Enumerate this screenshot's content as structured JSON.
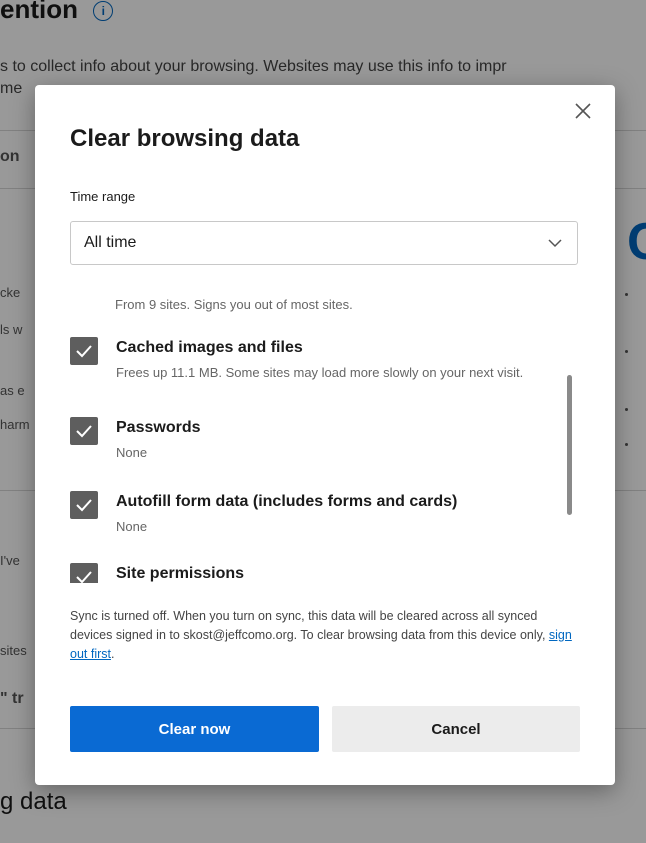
{
  "background": {
    "heading": "ention",
    "description_line1": "s to collect info about your browsing. Websites may use this info to impr",
    "description_line2": "me",
    "fragments": [
      "on",
      "cke",
      "ls w",
      "as e",
      "harm",
      "I've",
      "sites",
      "\" tr"
    ],
    "footer_heading": "g data"
  },
  "dialog": {
    "title": "Clear browsing data",
    "time_range": {
      "label": "Time range",
      "value": "All time"
    },
    "partial_item_desc": "From 9 sites. Signs you out of most sites.",
    "items": [
      {
        "label": "Cached images and files",
        "desc": "Frees up 11.1 MB. Some sites may load more slowly on your next visit.",
        "checked": true
      },
      {
        "label": "Passwords",
        "desc": "None",
        "checked": true
      },
      {
        "label": "Autofill form data (includes forms and cards)",
        "desc": "None",
        "checked": true
      },
      {
        "label": "Site permissions",
        "desc": "",
        "checked": true
      }
    ],
    "sync_notice": {
      "text": "Sync is turned off. When you turn on sync, this data will be cleared across all synced devices signed in to skost@jeffcomo.org. To clear browsing data from this device only,",
      "link": "sign out first",
      "trailing": "."
    },
    "primary_button": "Clear now",
    "secondary_button": "Cancel"
  },
  "colors": {
    "accent": "#0a6ad3",
    "checkbox": "#5e5e5e",
    "overlay": "rgba(0,0,0,0.40)"
  },
  "icons": {
    "close": "close-icon",
    "chevron": "chevron-down-icon",
    "check": "check-icon",
    "info": "info-icon"
  }
}
